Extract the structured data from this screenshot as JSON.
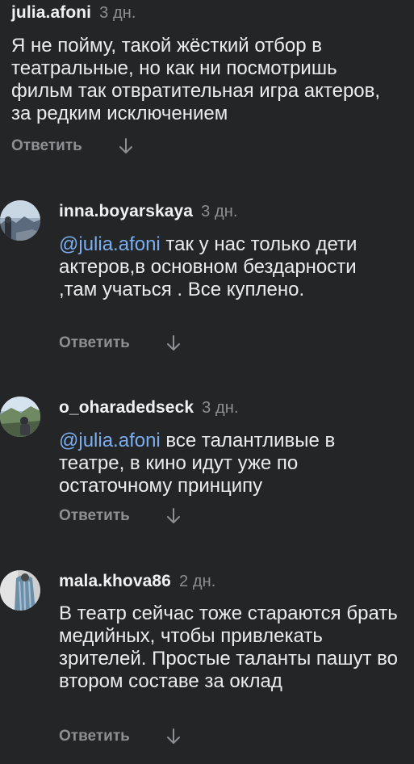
{
  "comments": [
    {
      "author": "julia.afoni",
      "time": "3 дн.",
      "mention": "",
      "text": "Я не пойму, такой жёсткий отбор в театральные, но как ни посмотришь фильм так отвратительная игра актеров, за редким исключением",
      "reply_label": "Ответить",
      "avatar_icon": "none"
    },
    {
      "author": "inna.boyarskaya",
      "time": "3 дн.",
      "mention": "@julia.afoni",
      "text": " так у нас только дети актеров,в основном бездарности ,там учаться . Все куплено.",
      "reply_label": "Ответить",
      "avatar_icon": "avatar-photo"
    },
    {
      "author": "o_oharadedseck",
      "time": "3 дн.",
      "mention": "@julia.afoni",
      "text": " все талантливые в театре, в кино идут уже по остаточному принципу",
      "reply_label": "Ответить",
      "avatar_icon": "avatar-photo"
    },
    {
      "author": "mala.khova86",
      "time": "2 дн.",
      "mention": "",
      "text": "В театр сейчас тоже стараются брать медийных, чтобы привлекать зрителей. Простые таланты пашут во втором составе за оклад",
      "reply_label": "Ответить",
      "avatar_icon": "avatar-photo"
    }
  ],
  "colors": {
    "background": "#242527",
    "mention": "#7aaef0",
    "muted": "#8e8f93",
    "text": "#ececed"
  }
}
